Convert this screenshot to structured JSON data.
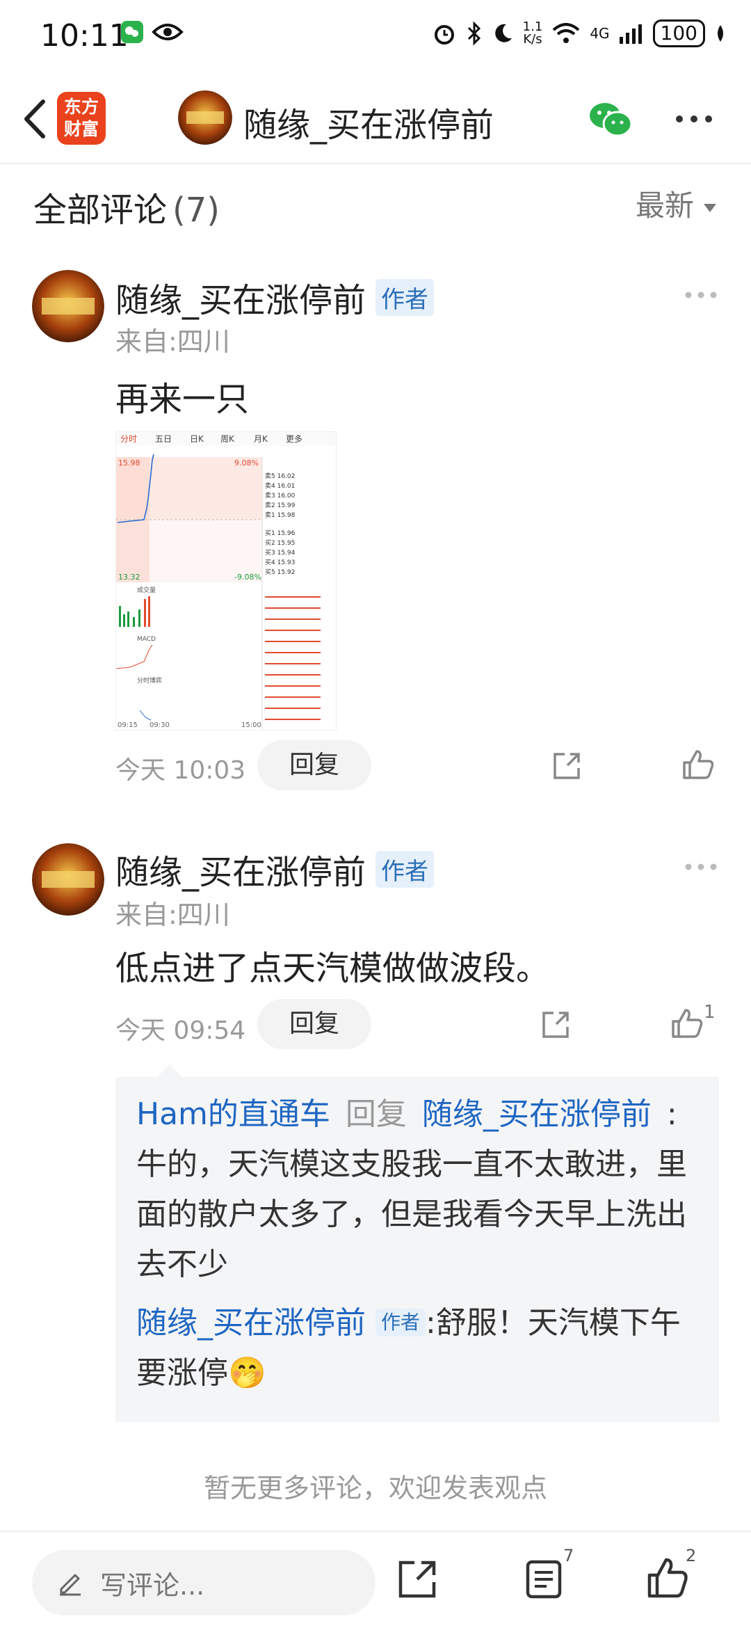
{
  "status_bar": {
    "time": "10:11",
    "net_speed_top": "1.1",
    "net_speed_bottom": "K/s",
    "network": "4G",
    "battery": "100"
  },
  "topbar": {
    "brand_logo_line1": "东方",
    "brand_logo_line2": "财富",
    "title": "随缘_买在涨停前"
  },
  "comments_header": {
    "label": "全部评论",
    "count": "(7)",
    "sort": "最新"
  },
  "comments": [
    {
      "author": "随缘_买在涨停前",
      "tag": "作者",
      "from": "来自:四川",
      "content": "再来一只",
      "time": "今天 10:03",
      "reply_label": "回复",
      "likes": ""
    },
    {
      "author": "随缘_买在涨停前",
      "tag": "作者",
      "from": "来自:四川",
      "content": "低点进了点天汽模做做波段。",
      "time": "今天 09:54",
      "reply_label": "回复",
      "likes": "1"
    }
  ],
  "replies": {
    "r1_user": "Ham的直通车",
    "r1_verb": "回复",
    "r1_target": "随缘_买在涨停前",
    "r1_colon": ":",
    "r1_text": "牛的，天汽模这支股我一直不太敢进，里面的散户太多了，但是我看今天早上洗出去不少",
    "r2_user": "随缘_买在涨停前",
    "r2_tag": "作者",
    "r2_text": ":舒服！天汽模下午要涨停🤭"
  },
  "footer_note": "暂无更多评论，欢迎发表观点",
  "bottom_bar": {
    "placeholder": "写评论...",
    "comments_count": "7",
    "likes_count": "2"
  },
  "chart_thumbnail": {
    "tabs": [
      "分时",
      "五日",
      "日K",
      "周K",
      "月K",
      "更多"
    ],
    "price_high": "15.98",
    "pct_high": "9.08%",
    "price_low": "13.32",
    "pct_low": "-9.08%",
    "time_start": "09:15",
    "time_mid": "09:30",
    "time_end": "15:00",
    "sell_levels": [
      "卖5 16.02",
      "卖4 16.01",
      "卖3 16.00",
      "卖2 15.99",
      "卖1 15.98"
    ],
    "buy_levels": [
      "买1 15.96",
      "买2 15.95",
      "买3 15.94",
      "买4 15.93",
      "买5 15.92"
    ],
    "panel_labels": [
      "成交量",
      "MACD",
      "分时博弈"
    ]
  }
}
